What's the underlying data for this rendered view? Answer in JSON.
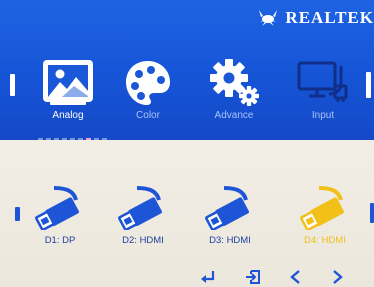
{
  "brand": {
    "name": "REALTEK"
  },
  "main_menu": {
    "items": [
      {
        "label": "Analog",
        "icon": "image-icon"
      },
      {
        "label": "Color",
        "icon": "palette-icon"
      },
      {
        "label": "Advance",
        "icon": "gear-icon"
      },
      {
        "label": "Input",
        "icon": "input-source-icon"
      }
    ],
    "active_index": 0
  },
  "page_indicator": {
    "count": 9,
    "active_index": 6
  },
  "input_sources": {
    "items": [
      {
        "label": "D1: DP",
        "icon": "cable-plug-icon"
      },
      {
        "label": "D2: HDMI",
        "icon": "cable-plug-icon"
      },
      {
        "label": "D3: HDMI",
        "icon": "cable-plug-icon"
      },
      {
        "label": "D4: HDMI",
        "icon": "cable-plug-icon"
      }
    ],
    "selected_index": 3
  },
  "nav_hints": [
    "enter-icon",
    "exit-icon",
    "chevron-left-icon",
    "chevron-right-icon"
  ],
  "colors": {
    "top_bg": "#1654d6",
    "bottom_bg": "#efebe2",
    "icon_blue": "#1d55d6",
    "selected_yellow": "#f2c018"
  }
}
